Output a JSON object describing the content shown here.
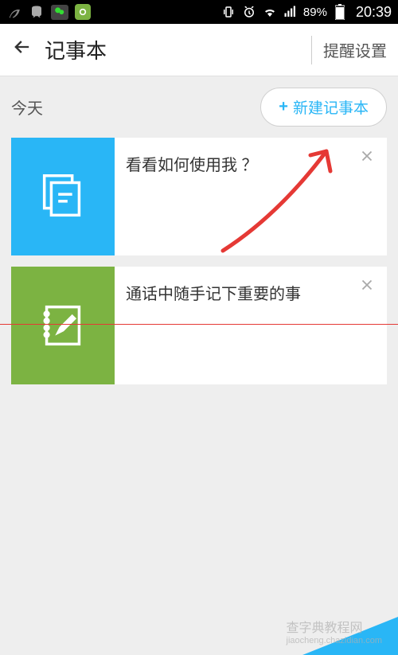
{
  "statusBar": {
    "battery": "89%",
    "time": "20:39"
  },
  "header": {
    "title": "记事本",
    "settingsLink": "提醒设置"
  },
  "section": {
    "label": "今天",
    "newButtonLabel": "新建记事本",
    "plusSymbol": "+"
  },
  "cards": [
    {
      "title": "看看如何使用我 ？",
      "iconColor": "blue",
      "iconName": "document-icon"
    },
    {
      "title": "通话中随手记下重要的事",
      "iconColor": "green",
      "iconName": "notepad-edit-icon"
    }
  ],
  "watermark": {
    "text1": "查字典教程网",
    "text2": "jiaocheng.chazidian.com"
  }
}
